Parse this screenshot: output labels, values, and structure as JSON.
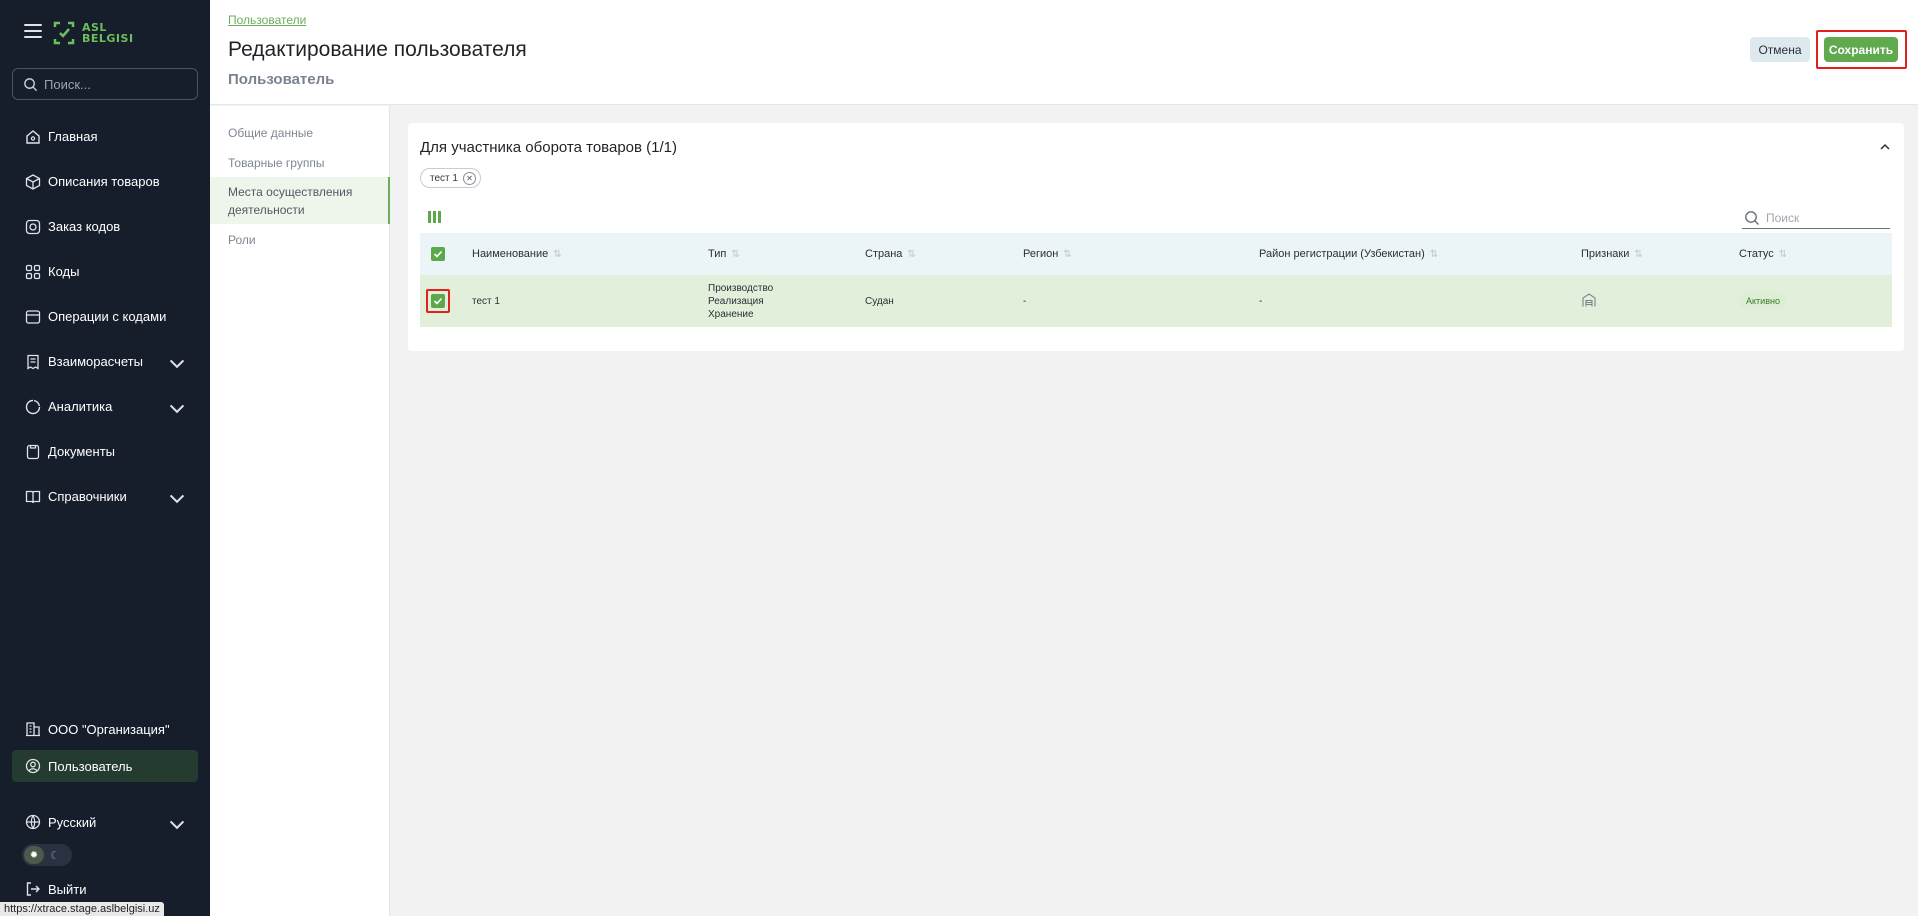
{
  "sidebar": {
    "logo_text_1": "ASL",
    "logo_text_2": "BELGISI",
    "search_placeholder": "Поиск...",
    "items": [
      {
        "label": "Главная",
        "icon": "home-icon"
      },
      {
        "label": "Описания товаров",
        "icon": "box-icon"
      },
      {
        "label": "Заказ кодов",
        "icon": "order-icon"
      },
      {
        "label": "Коды",
        "icon": "codes-icon"
      },
      {
        "label": "Операции с кодами",
        "icon": "operations-icon"
      },
      {
        "label": "Взаиморасчеты",
        "icon": "receipt-icon"
      },
      {
        "label": "Аналитика",
        "icon": "analytics-icon"
      },
      {
        "label": "Документы",
        "icon": "document-icon"
      },
      {
        "label": "Справочники",
        "icon": "book-icon"
      }
    ],
    "organization": "ООО \"Организация\"",
    "user": "Пользователь",
    "language": "Русский",
    "logout": "Выйти"
  },
  "status_url": "https://xtrace.stage.aslbelgisi.uz",
  "header": {
    "breadcrumb": "Пользователи",
    "title": "Редактирование пользователя",
    "subtitle": "Пользователь",
    "cancel_label": "Отмена",
    "save_label": "Сохранить"
  },
  "subnav": {
    "items": [
      "Общие данные",
      "Товарные группы",
      "Места осуществления деятельности",
      "Роли"
    ],
    "active_index": 2
  },
  "card": {
    "title": "Для участника оборота товаров (1/1)",
    "chip": "тест 1",
    "search_placeholder": "Поиск",
    "columns": [
      "Наименование",
      "Тип",
      "Страна",
      "Регион",
      "Район регистрации (Узбекистан)",
      "Признаки",
      "Статус"
    ],
    "rows": [
      {
        "name": "тест 1",
        "types": [
          "Производство",
          "Реализация",
          "Хранение"
        ],
        "country": "Судан",
        "region": "-",
        "district": "-",
        "status": "Активно",
        "checked": true
      }
    ]
  },
  "colors": {
    "sidebar_bg": "#161d2b",
    "accent": "#61a94f",
    "highlight": "#e0221c"
  }
}
